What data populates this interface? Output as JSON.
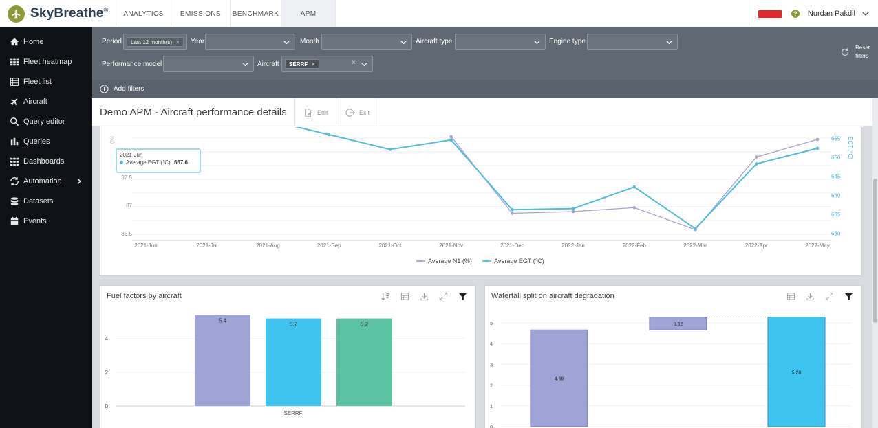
{
  "app": {
    "name": "SkyBreathe",
    "trademark": "®"
  },
  "nav": {
    "tabs": [
      "ANALYTICS",
      "EMISSIONS",
      "BENCHMARK",
      "APM"
    ],
    "active": "APM"
  },
  "user": {
    "name": "Nurdan Pakdil",
    "help": "?"
  },
  "sidebar": {
    "items": [
      {
        "label": "Home",
        "icon": "home-icon"
      },
      {
        "label": "Fleet heatmap",
        "icon": "grid-icon"
      },
      {
        "label": "Fleet list",
        "icon": "list-icon"
      },
      {
        "label": "Aircraft",
        "icon": "airplane-icon"
      },
      {
        "label": "Query editor",
        "icon": "search-icon"
      },
      {
        "label": "Queries",
        "icon": "bar-chart-icon"
      },
      {
        "label": "Dashboards",
        "icon": "dashboard-icon"
      },
      {
        "label": "Automation",
        "icon": "automation-icon"
      },
      {
        "label": "Datasets",
        "icon": "database-icon"
      },
      {
        "label": "Events",
        "icon": "calendar-icon"
      }
    ]
  },
  "filters": {
    "period_label": "Period",
    "period_value": "Last 12 month(s)",
    "year_label": "Year",
    "month_label": "Month",
    "aircraft_type_label": "Aircraft type",
    "engine_type_label": "Engine type",
    "performance_model_label": "Performance model",
    "aircraft_label": "Aircraft",
    "aircraft_value": "SERRF",
    "chip_remove": "×",
    "clear": "×",
    "reset_line1": "Reset",
    "reset_line2": "filters",
    "add_filters": "Add filters"
  },
  "page": {
    "title": "Demo APM  -  Aircraft performance details",
    "edit_label": "Edit",
    "exit_label": "Exit"
  },
  "tooltip": {
    "title": "2021-Jun",
    "series": "Average EGT (°C):",
    "value": "667.6"
  },
  "colors": {
    "n1": "#a9a2cf",
    "egt": "#4fbde0",
    "bar_purple": "#9fa4d6",
    "bar_blue": "#3ec4ef",
    "bar_green": "#5bc2a2"
  },
  "line_chart": {
    "chart_data": {
      "type": "line",
      "x": [
        "2021-Jun",
        "2021-Jul",
        "2021-Aug",
        "2021-Sep",
        "2021-Oct",
        "2021-Nov",
        "2021-Dec",
        "2022-Jan",
        "2022-Feb",
        "2022-Mar",
        "2022-Apr",
        "2022-May"
      ],
      "y_left_ticks": [
        "86.5",
        "87",
        "87.5"
      ],
      "y_left_label": "(%)",
      "y_right_ticks": [
        "630",
        "635",
        "640",
        "645",
        "650",
        "655"
      ],
      "y_right_label": "EGT (°C)",
      "legend_position": "bottom",
      "series": [
        {
          "name": "Average N1 (%)",
          "axis": "left",
          "values": [
            null,
            null,
            null,
            null,
            null,
            88.22,
            86.86,
            86.89,
            86.96,
            86.57,
            87.86,
            88.17
          ]
        },
        {
          "name": "Average EGT (°C)",
          "axis": "right",
          "values": [
            667.6,
            null,
            null,
            656,
            652.1,
            654.6,
            636.2,
            636.5,
            642.2,
            631.2,
            648.3,
            652.4
          ]
        }
      ]
    }
  },
  "fuel_chart": {
    "title": "Fuel factors by aircraft",
    "chart_data": {
      "type": "bar",
      "categories": [
        "SERRF"
      ],
      "y_ticks": [
        "0",
        "2",
        "4"
      ],
      "series": [
        {
          "values": [
            5.4
          ],
          "label": "5.4"
        },
        {
          "values": [
            5.2
          ],
          "label": "5.2"
        },
        {
          "values": [
            5.2
          ],
          "label": "5.2"
        }
      ]
    }
  },
  "waterfall_chart": {
    "title": "Waterfall split on aircraft degradation",
    "chart_data": {
      "type": "bar",
      "y_ticks": [
        "0",
        "1",
        "2",
        "3",
        "4",
        "5"
      ],
      "steps": [
        {
          "base": 0,
          "value": 4.66,
          "label": "4.66"
        },
        {
          "base": 4.66,
          "value": 0.62,
          "label": "0.62"
        },
        {
          "base": 0,
          "value": 5.28,
          "label": "5.28"
        }
      ]
    }
  }
}
